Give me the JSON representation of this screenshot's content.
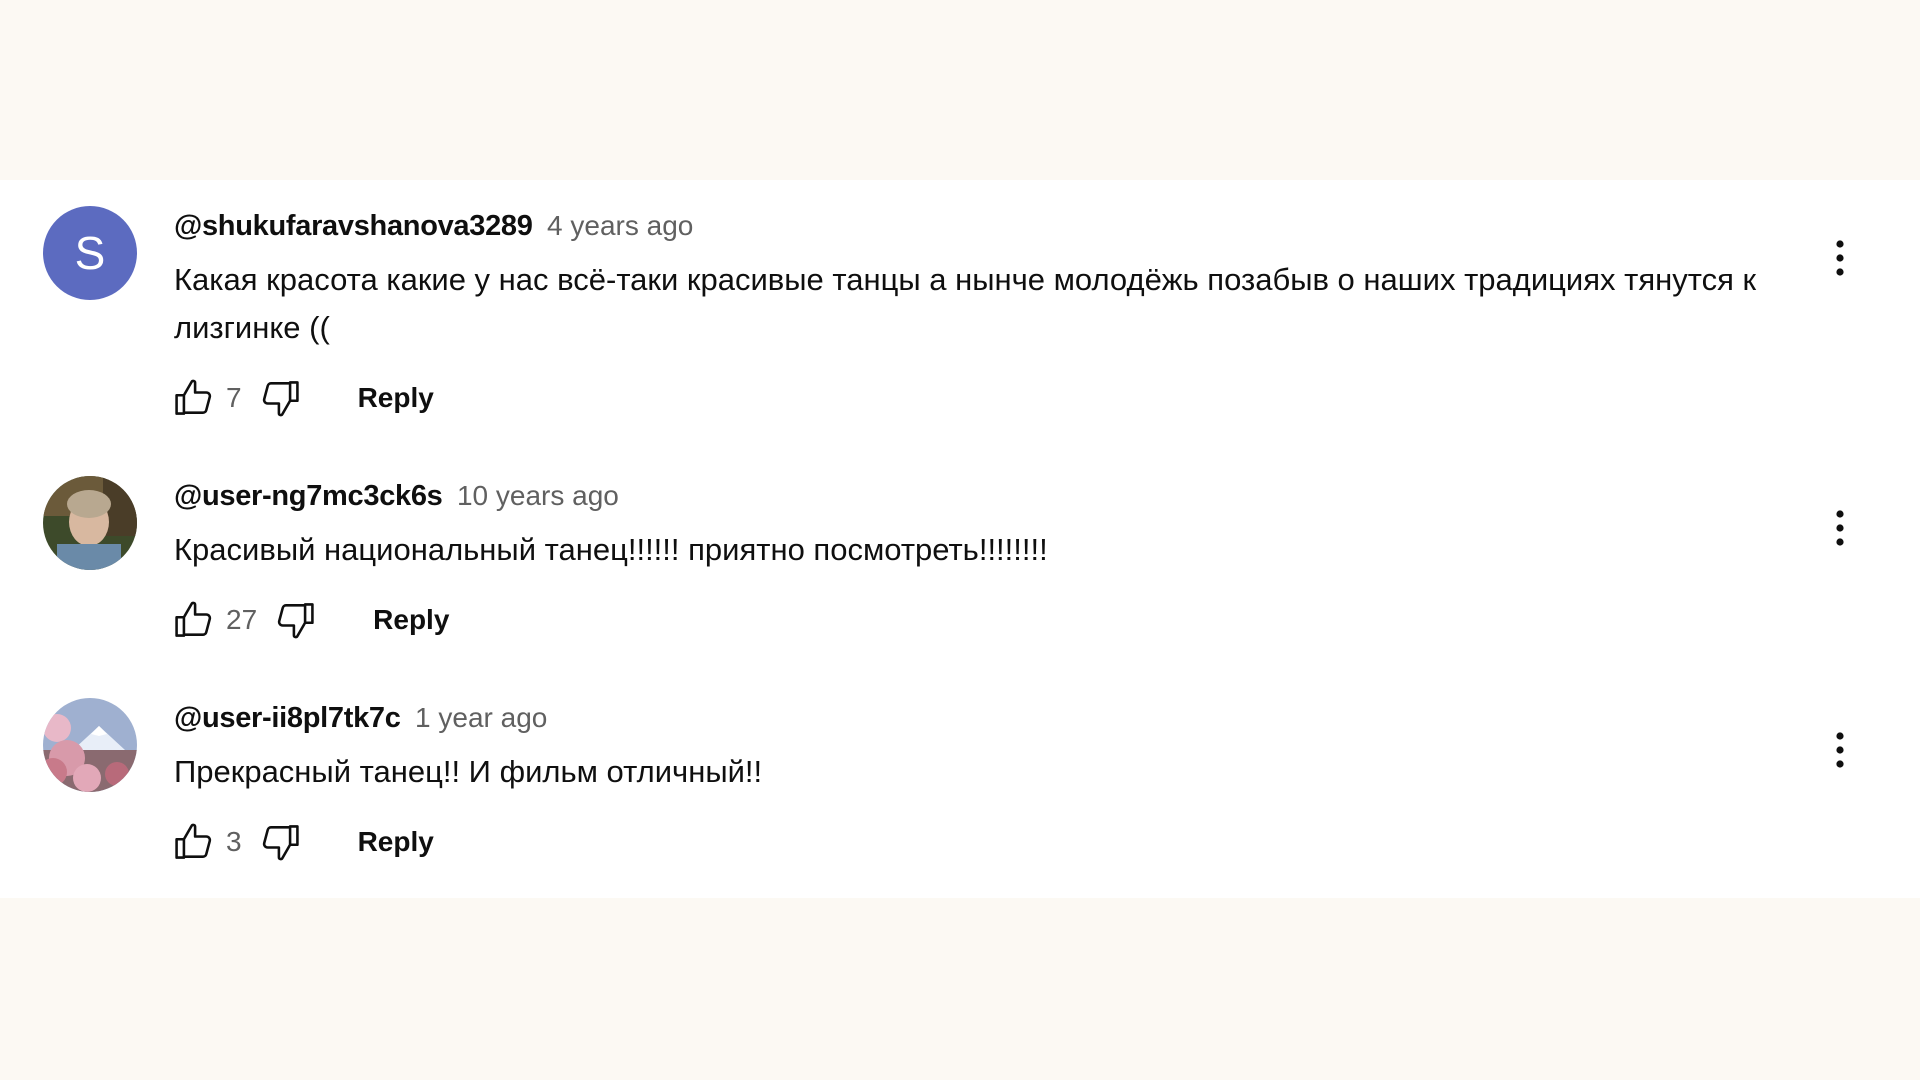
{
  "comments": [
    {
      "author": "@shukufaravshanova3289",
      "time": "4 years ago",
      "text": "Какая красота какие у нас всё-таки красивые танцы а нынче молодёжь позабыв о наших традициях тянутся к лизгинке ((",
      "avatar_letter": "S",
      "avatar_color": "#5c6bc0",
      "likes": "7",
      "reply_label": "Reply"
    },
    {
      "author": "@user-ng7mc3ck6s",
      "time": "10 years ago",
      "text": "Красивый национальный танец!!!!!! приятно посмотреть!!!!!!!!",
      "likes": "27",
      "reply_label": "Reply"
    },
    {
      "author": "@user-ii8pl7tk7c",
      "time": "1 year ago",
      "text": "Прекрасный танец!! И фильм отличный!!",
      "likes": "3",
      "reply_label": "Reply"
    }
  ],
  "icons": {
    "like": "thumb-up-icon",
    "dislike": "thumb-down-icon",
    "menu": "more-vert-icon"
  },
  "colors": {
    "page_background": "#fcf9f3",
    "panel_background": "#ffffff",
    "text_primary": "#0f0f0f",
    "text_secondary": "#606060",
    "avatar_letter_bg": "#5c6bc0"
  }
}
